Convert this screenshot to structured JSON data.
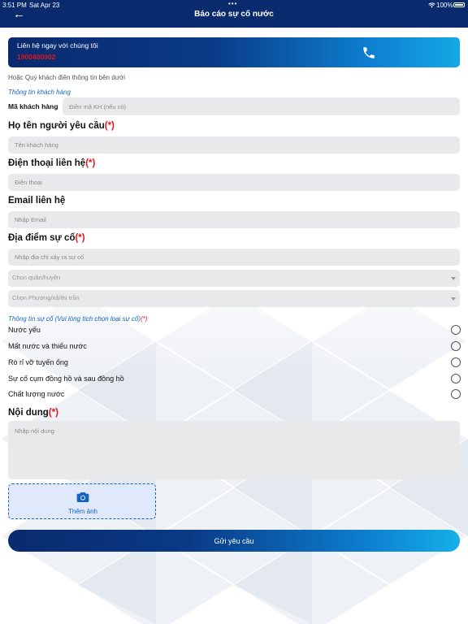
{
  "status_bar": {
    "time": "3:51 PM",
    "date": "Sat Apr 23",
    "dots": "•••",
    "wifi_icon": "wifi-icon",
    "battery": "100%"
  },
  "header": {
    "back_icon": "arrow-left-icon",
    "back_glyph": "←",
    "title": "Báo cáo sự cố nước",
    "color": "#0a2a6e"
  },
  "hotline": {
    "label": "Liên hệ ngay với chúng tôi",
    "number": "1900400002",
    "icon": "phone-icon",
    "number_color": "#e3141b"
  },
  "hint": "Hoặc Quý khách điền thông tin bên dưới",
  "customer_section": {
    "title": "Thông tin khách hàng",
    "code_label": "Mã khách hàng",
    "code_placeholder": "Điền mã KH (nếu có)"
  },
  "fields": {
    "name": {
      "label": "Họ tên người yêu cầu",
      "required": "(*)",
      "placeholder": "Tên khách hàng"
    },
    "phone": {
      "label": "Điện thoại liên hệ",
      "required": "(*)",
      "placeholder": "Điện thoại"
    },
    "email": {
      "label": "Email liên hệ",
      "placeholder": "Nhập Email"
    },
    "location": {
      "label": "Địa điểm sự cố",
      "required": "(*)",
      "placeholder": "Nhập địa chỉ xảy ra sự cố",
      "district_placeholder": "Chọn quận/huyện",
      "ward_placeholder": "Chọn Phường/xã/thị trấn"
    },
    "content": {
      "label": "Nội dung",
      "required": "(*)",
      "placeholder": "Nhập nội dung"
    }
  },
  "incident_section": {
    "title": "Thông tin sự cố (Vui lòng tích chọn loại sự cố)",
    "required": "(*)",
    "options": [
      "Nước yếu",
      "Mất nước và thiếu nước",
      "Rò rỉ vỡ tuyến ống",
      "Sự cố cụm đồng hồ và sau đồng hồ",
      "Chất lượng nước"
    ]
  },
  "photo": {
    "label": "Thêm ảnh",
    "icon": "camera-icon"
  },
  "submit": {
    "label": "Gửi yêu cầu"
  },
  "colors": {
    "primary_dark": "#0a2a6e",
    "primary_light": "#14a8e6",
    "required": "#e3141b",
    "section_blue": "#1565c0"
  }
}
